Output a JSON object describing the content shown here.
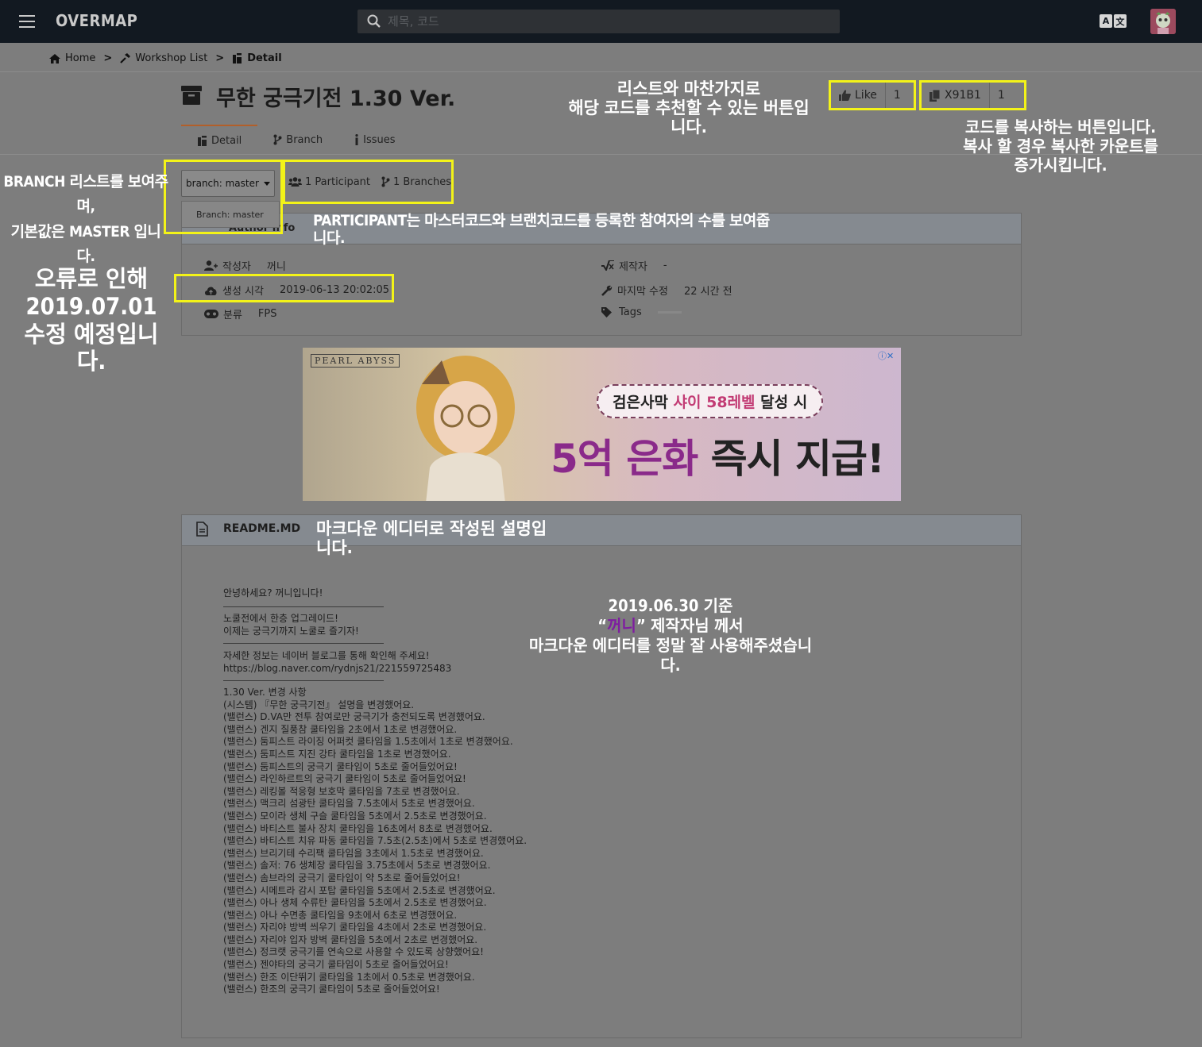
{
  "app": {
    "logo": "OVERMAP",
    "search_placeholder": "제목, 코드",
    "lang_a": "A",
    "lang_b": "文"
  },
  "breadcrumb": {
    "home": "Home",
    "workshop": "Workshop List",
    "detail": "Detail",
    "separator": ">"
  },
  "title": "무한 궁극기전 1.30 Ver.",
  "actions": {
    "like_label": "Like",
    "like_count": "1",
    "code_label": "X91B1",
    "code_count": "1"
  },
  "tabs": [
    "Detail",
    "Branch",
    "Issues"
  ],
  "branch": {
    "button": "branch: master",
    "menu_item": "Branch: master",
    "participants": "1 Participant",
    "branches": "1 Branches"
  },
  "author_panel": {
    "title": "Author Info",
    "left": [
      {
        "icon": "user-icon",
        "label": "작성자",
        "value": "꺼니"
      },
      {
        "icon": "cloud-upload-icon",
        "label": "생성 시각",
        "value": "2019-06-13 20:02:05"
      },
      {
        "icon": "gamepad-icon",
        "label": "분류",
        "value": "FPS"
      }
    ],
    "right": [
      {
        "icon": "function-icon",
        "label": "제작자",
        "value": "-"
      },
      {
        "icon": "wrench-icon",
        "label": "마지막 수정",
        "value": "22 시간 전"
      },
      {
        "icon": "tags-icon",
        "label": "Tags",
        "value": ""
      }
    ]
  },
  "ad": {
    "brand": "PEARL ABYSS",
    "pill_prefix": "검은사막 ",
    "pill_highlight": "샤이 58레벨",
    "pill_suffix": " 달성 시",
    "big_highlight": "5억 은화",
    "big_suffix": " 즉시 지급!"
  },
  "readme": {
    "title": "README.MD",
    "intro": "안녕하세요? 꺼니입니다!",
    "para1": [
      "노쿨전에서 한층 업그레이드!",
      "이제는 궁극기까지 노쿨로 즐기자!"
    ],
    "para2": [
      "자세한 정보는 네이버 블로그를 통해 확인해 주세요!",
      "https://blog.naver.com/rydnjs21/221559725483"
    ],
    "changelog": [
      "1.30 Ver. 변경 사항",
      "(시스템) 『무한 궁극기전』 설명을 변경했어요.",
      "(밸런스) D.VA만 전투 참여로만 궁극기가 충전되도록 변경했어요.",
      "(밸런스) 겐지 질풍참 쿨타임을 2초에서 1초로 변경했어요.",
      "(밸런스) 둠피스트 라이징 어퍼컷 쿨타임을 1.5초에서 1초로 변경했어요.",
      "(밸런스) 둠피스트 지진 강타 쿨타임을 1초로 변경했어요.",
      "(밸런스) 둠피스트의 궁극기 쿨타임이 5초로 줄어들었어요!",
      "(밸런스) 라인하르트의 궁극기 쿨타임이 5초로 줄어들었어요!",
      "(밸런스) 레킹볼 적응형 보호막 쿨타임을 7초로 변경했어요.",
      "(밸런스) 맥크리 섬광탄 쿨타임을 7.5초에서 5초로 변경했어요.",
      "(밸런스) 모이라 생체 구슬 쿨타임을 5초에서 2.5초로 변경했어요.",
      "(밸런스) 바티스트 불사 장치 쿨타임을 16초에서 8초로 변경했어요.",
      "(밸런스) 바티스트 치유 파동 쿨타임을 7.5초(2.5초)에서 5초로 변경했어요.",
      "(밸런스) 브리기테 수리팩 쿨타임을 3초에서 1.5초로 변경했어요.",
      "(밸런스) 솔저: 76 생체장 쿨타임을 3.75초에서 5초로 변경했어요.",
      "(밸런스) 솜브라의 궁극기 쿨타임이 약 5초로 줄어들었어요!",
      "(밸런스) 시메트라 감시 포탑 쿨타임을 5초에서 2.5초로 변경했어요.",
      "(밸런스) 아나 생체 수류탄 쿨타임을 5초에서 2.5초로 변경했어요.",
      "(밸런스) 아나 수면총 쿨타임을 9초에서 6초로 변경했어요.",
      "(밸런스) 자리야 방벽 씌우기 쿨타임을 4초에서 2초로 변경했어요.",
      "(밸런스) 자리야 입자 방벽 쿨타임을 5초에서 2초로 변경했어요.",
      "(밸런스) 정크랫 궁극기를 연속으로 사용할 수 있도록 상향했어요!",
      "(밸런스) 젠야타의 궁극기 쿨타임이 5초로 줄어들었어요!",
      "(밸런스) 한조 이단뛰기 쿨타임을 1초에서 0.5초로 변경했어요.",
      "(밸런스) 한조의 궁극기 쿨타임이 5초로 줄어들었어요!"
    ]
  },
  "annotations": {
    "like": [
      "리스트와 마찬가지로",
      "해당 코드를 추천할 수 있는 버튼입니다."
    ],
    "copy": [
      "코드를 복사하는 버튼입니다.",
      "복사 할 경우 복사한 카운트를",
      "증가시킵니다."
    ],
    "branch": [
      "BRANCH 리스트를 보여주며,",
      "기본값은 MASTER 입니다."
    ],
    "participant": "PARTICIPANT는 마스터코드와 브랜치코드를 등록한 참여자의 수를 보여줍니다.",
    "error": [
      "오류로 인해",
      "2019.07.01",
      "수정 예정입니다."
    ],
    "readme": "마크다운 에디터로 작성된 설명입니다.",
    "credit_line1": "2019.06.30 기준",
    "credit_quote_open": "“",
    "credit_name": "꺼니",
    "credit_quote_rest": "” 제작자님 께서",
    "credit_line3": "마크다운 에디터를 정말 잘 사용해주셨습니다."
  },
  "colors": {
    "highlight": "#f3f318",
    "topbar": "#121921",
    "accent_tab": "#b25f2a"
  }
}
